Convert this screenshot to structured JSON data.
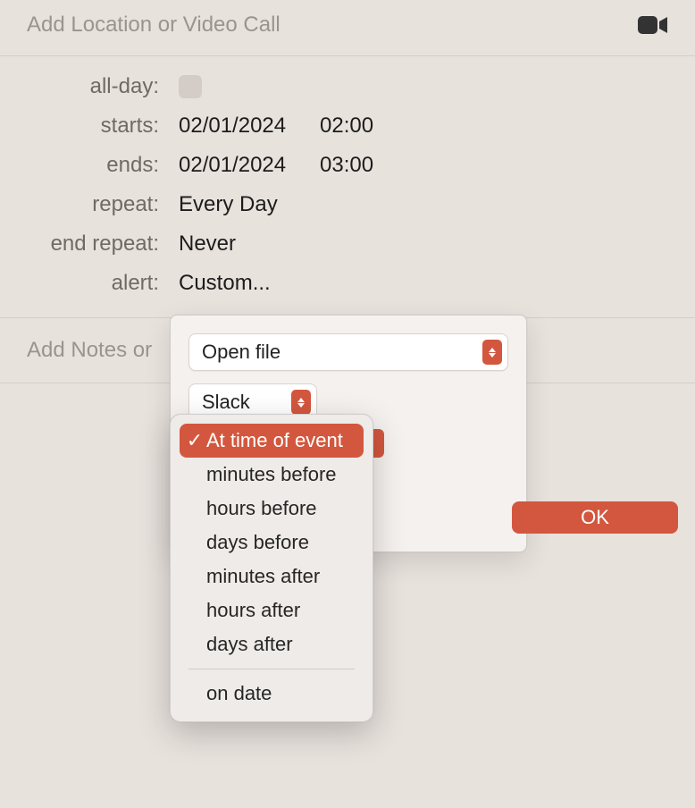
{
  "location": {
    "placeholder": "Add Location or Video Call"
  },
  "form": {
    "allDay": {
      "label": "all-day:",
      "checked": false
    },
    "starts": {
      "label": "starts:",
      "date": "02/01/2024",
      "time": "02:00"
    },
    "ends": {
      "label": "ends:",
      "date": "02/01/2024",
      "time": "03:00"
    },
    "repeat": {
      "label": "repeat:",
      "value": "Every Day"
    },
    "endRepeat": {
      "label": "end repeat:",
      "value": "Never"
    },
    "alert": {
      "label": "alert:",
      "value": "Custom..."
    }
  },
  "notes": {
    "placeholder": "Add Notes or"
  },
  "popover": {
    "action": {
      "value": "Open file"
    },
    "file": {
      "value": "Slack"
    },
    "okLabel": "OK"
  },
  "timingMenu": {
    "selected": "At time of event",
    "items": [
      "At time of event",
      "minutes before",
      "hours before",
      "days before",
      "minutes after",
      "hours after",
      "days after"
    ],
    "footerItem": "on date"
  },
  "colors": {
    "accent": "#d3573e"
  }
}
